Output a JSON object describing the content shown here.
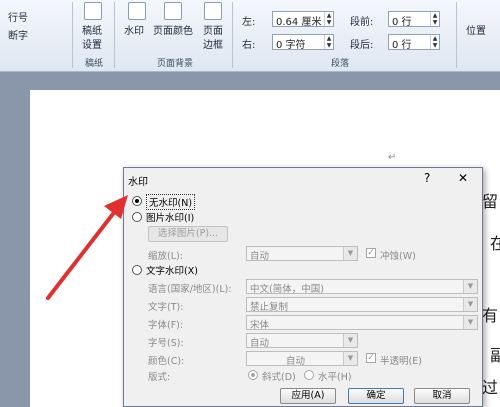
{
  "ribbon": {
    "left_items": [
      "行号",
      "断字"
    ],
    "manuscript": {
      "line1": "稿纸",
      "line2": "设置",
      "group": "稿纸"
    },
    "page_bg": {
      "watermark": "水印",
      "page_color": "页面颜色",
      "page_border_1": "页面",
      "page_border_2": "边框",
      "group": "页面背景"
    },
    "indent": {
      "left_label": "左:",
      "left_value": "0.64 厘米",
      "right_label": "右:",
      "right_value": "0 字符"
    },
    "spacing": {
      "before_label": "段前:",
      "before_value": "0 行",
      "after_label": "段后:",
      "after_value": "0 行"
    },
    "paragraph_group": "段落",
    "position": "位置"
  },
  "document": {
    "frag1": "留",
    "frag2": "在",
    "frag3": "有",
    "frag4": "副",
    "frag5": "过",
    "para_mark": "↵"
  },
  "dialog": {
    "title": "水印",
    "help": "?",
    "close": "✕",
    "no_watermark": "无水印(N)",
    "picture_watermark": "图片水印(I)",
    "select_picture": "选择图片(P)...",
    "scale_label": "缩放(L):",
    "scale_value": "自动",
    "washout": "冲蚀(W)",
    "text_watermark": "文字水印(X)",
    "language_label": "语言(国家/地区)(L):",
    "language_value": "中文(简体，中国)",
    "text_label": "文字(T):",
    "text_value": "禁止复制",
    "font_label": "字体(F):",
    "font_value": "宋体",
    "size_label": "字号(S):",
    "size_value": "自动",
    "color_label": "颜色(C):",
    "color_value": "自动",
    "semitransparent": "半透明(E)",
    "layout_label": "版式:",
    "diagonal": "斜式(D)",
    "horizontal": "水平(H)",
    "apply": "应用(A)",
    "ok": "确定",
    "cancel": "取消"
  },
  "colors": {
    "accent": "#3c7fb1",
    "arrow": "#e03030"
  }
}
